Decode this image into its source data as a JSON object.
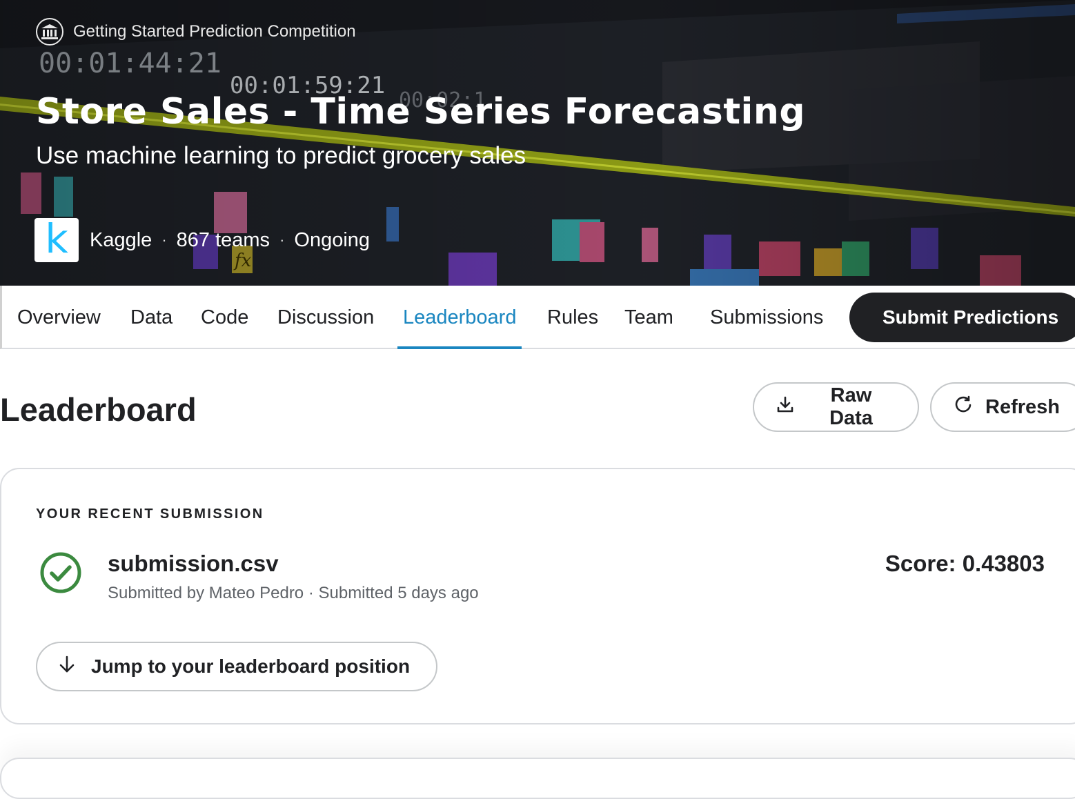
{
  "hero": {
    "eyebrow": "Getting Started Prediction Competition",
    "title": "Store Sales - Time Series Forecasting",
    "subtitle": "Use machine learning to predict grocery sales",
    "logo_letter": "k",
    "host": "Kaggle",
    "teams": "867 teams",
    "status": "Ongoing",
    "separator": "·",
    "background_text": [
      "00:01:44:21",
      "00:01:59:21",
      "00:02:1",
      "fx"
    ]
  },
  "tabs": [
    {
      "label": "Overview",
      "active": false
    },
    {
      "label": "Data",
      "active": false
    },
    {
      "label": "Code",
      "active": false
    },
    {
      "label": "Discussion",
      "active": false
    },
    {
      "label": "Leaderboard",
      "active": true
    },
    {
      "label": "Rules",
      "active": false
    },
    {
      "label": "Team",
      "active": false
    },
    {
      "label": "Submissions",
      "active": false
    }
  ],
  "submit_label": "Submit Predictions",
  "page_title": "Leaderboard",
  "actions": {
    "raw_data": {
      "label": "Raw Data",
      "icon": "download-icon"
    },
    "refresh": {
      "label": "Refresh",
      "icon": "refresh-icon"
    }
  },
  "recent": {
    "heading": "YOUR RECENT SUBMISSION",
    "status_icon": "check-circle-icon",
    "file_name": "submission.csv",
    "meta": "Submitted by Mateo Pedro · Submitted 5 days ago",
    "score": "Score: 0.43803",
    "jump_label": "Jump to your leaderboard position",
    "jump_icon": "arrow-down-icon"
  },
  "colors": {
    "accent": "#1a86c0",
    "success": "#3b8a3f",
    "kaggle_blue": "#20beff",
    "dark_button": "#202124"
  }
}
